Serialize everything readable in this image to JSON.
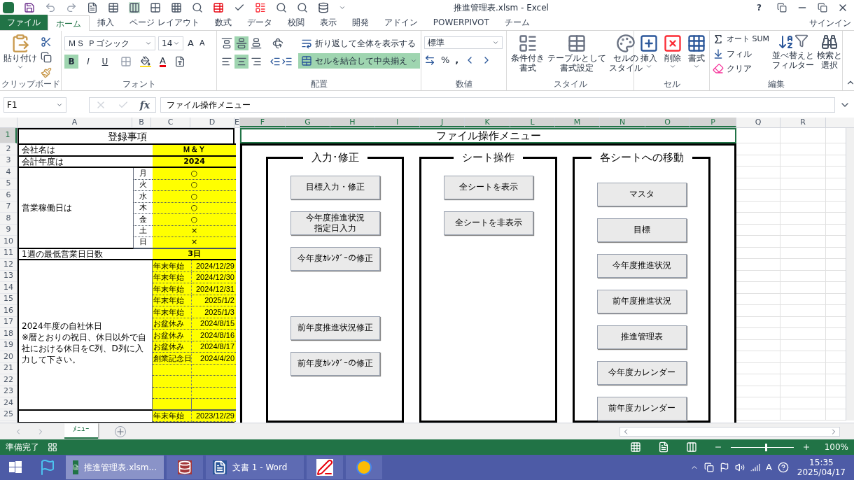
{
  "window": {
    "title": "推進管理表.xlsm - Excel",
    "help": "?"
  },
  "ribbon_tabs": [
    {
      "label": "ファイル",
      "kind": "file",
      "selected": false
    },
    {
      "label": "ホーム",
      "kind": "tab",
      "selected": true
    },
    {
      "label": "挿入",
      "kind": "tab",
      "selected": false
    },
    {
      "label": "ページ レイアウト",
      "kind": "tab",
      "selected": false
    },
    {
      "label": "数式",
      "kind": "tab",
      "selected": false
    },
    {
      "label": "データ",
      "kind": "tab",
      "selected": false
    },
    {
      "label": "校閲",
      "kind": "tab",
      "selected": false
    },
    {
      "label": "表示",
      "kind": "tab",
      "selected": false
    },
    {
      "label": "開発",
      "kind": "tab",
      "selected": false
    },
    {
      "label": "アドイン",
      "kind": "tab",
      "selected": false
    },
    {
      "label": "POWERPIVOT",
      "kind": "tab",
      "selected": false
    },
    {
      "label": "チーム",
      "kind": "tab",
      "selected": false
    }
  ],
  "sign_in": "サインイン",
  "ribbon": {
    "clipboard": {
      "label": "クリップボード",
      "paste": "貼り付け"
    },
    "font": {
      "label": "フォント",
      "name": "ＭＳ Ｐゴシック",
      "size": "14",
      "grow": "A",
      "shrink": "A",
      "font_color": "A",
      "styles": [
        {
          "kind": "bold",
          "text": "B",
          "selected": true
        },
        {
          "kind": "italic",
          "text": "I",
          "selected": false
        },
        {
          "kind": "underline",
          "text": "U",
          "selected": false
        }
      ]
    },
    "alignment": {
      "label": "配置",
      "wrap": "折り返して全体を表示する",
      "merge": "セルを結合して中央揃え",
      "merge_selected": true,
      "vertical": [
        {
          "kind": "top",
          "selected": false
        },
        {
          "kind": "middle",
          "selected": true
        },
        {
          "kind": "bottom",
          "selected": false
        }
      ],
      "horizontal": [
        {
          "kind": "left",
          "selected": false
        },
        {
          "kind": "center",
          "selected": true
        },
        {
          "kind": "right",
          "selected": false
        }
      ]
    },
    "number": {
      "label": "数値",
      "format": "標準",
      "percent": "%",
      "comma": ","
    },
    "styles": {
      "label": "スタイル",
      "buttons": [
        {
          "kind": "conditional",
          "lines": [
            "条件付き",
            "書式"
          ]
        },
        {
          "kind": "table",
          "lines": [
            "テーブルとして",
            "書式設定"
          ]
        },
        {
          "kind": "cellstyle",
          "lines": [
            "セルの",
            "スタイル"
          ]
        }
      ]
    },
    "cells": {
      "label": "セル",
      "buttons": [
        {
          "kind": "insert",
          "label": "挿入"
        },
        {
          "kind": "delete",
          "label": "削除"
        },
        {
          "kind": "format",
          "label": "書式"
        }
      ]
    },
    "editing": {
      "label": "編集",
      "autosum": "オート SUM",
      "fill": "フィル",
      "clear": "クリア",
      "sort": [
        "並べ替えと",
        "フィルター"
      ],
      "find": [
        "検索と",
        "選択"
      ]
    }
  },
  "formula_bar": {
    "name_box": "F1",
    "fx": "fx",
    "formula": "ファイル操作メニュー"
  },
  "columns": [
    {
      "label": "A",
      "selected": false
    },
    {
      "label": "B",
      "selected": false
    },
    {
      "label": "C",
      "selected": false
    },
    {
      "label": "D",
      "selected": false
    },
    {
      "label": "E",
      "selected": false
    },
    {
      "label": "F",
      "selected": true
    },
    {
      "label": "G",
      "selected": true
    },
    {
      "label": "H",
      "selected": true
    },
    {
      "label": "I",
      "selected": true
    },
    {
      "label": "J",
      "selected": true
    },
    {
      "label": "K",
      "selected": true
    },
    {
      "label": "L",
      "selected": true
    },
    {
      "label": "M",
      "selected": true
    },
    {
      "label": "N",
      "selected": true
    },
    {
      "label": "O",
      "selected": true
    },
    {
      "label": "P",
      "selected": true
    },
    {
      "label": "Q",
      "selected": false
    },
    {
      "label": "R",
      "selected": false
    }
  ],
  "rows": [
    {
      "label": "1",
      "selected": true
    },
    {
      "label": "2",
      "selected": false
    },
    {
      "label": "3",
      "selected": false
    },
    {
      "label": "4",
      "selected": false
    },
    {
      "label": "5",
      "selected": false
    },
    {
      "label": "6",
      "selected": false
    },
    {
      "label": "7",
      "selected": false
    },
    {
      "label": "8",
      "selected": false
    },
    {
      "label": "9",
      "selected": false
    },
    {
      "label": "10",
      "selected": false
    },
    {
      "label": "11",
      "selected": false
    },
    {
      "label": "12",
      "selected": false
    },
    {
      "label": "13",
      "selected": false
    },
    {
      "label": "14",
      "selected": false
    },
    {
      "label": "15",
      "selected": false
    },
    {
      "label": "16",
      "selected": false
    },
    {
      "label": "17",
      "selected": false
    },
    {
      "label": "18",
      "selected": false
    },
    {
      "label": "19",
      "selected": false
    },
    {
      "label": "20",
      "selected": false
    },
    {
      "label": "21",
      "selected": false
    },
    {
      "label": "22",
      "selected": false
    },
    {
      "label": "23",
      "selected": false
    },
    {
      "label": "24",
      "selected": false
    },
    {
      "label": "25",
      "selected": false
    }
  ],
  "registration": {
    "title": "登録事項",
    "company": {
      "label": "会社名は",
      "value": "Ｍ＆Ｙ"
    },
    "fiscal_year": {
      "label": "会計年度は",
      "value": "2024"
    },
    "workdays": {
      "label": "営業稼働日は",
      "days": [
        {
          "day": "月",
          "mark": "○"
        },
        {
          "day": "火",
          "mark": "○"
        },
        {
          "day": "水",
          "mark": "○"
        },
        {
          "day": "木",
          "mark": "○"
        },
        {
          "day": "金",
          "mark": "○"
        },
        {
          "day": "土",
          "mark": "×"
        },
        {
          "day": "日",
          "mark": "×"
        }
      ]
    },
    "min_days": {
      "label": "1週の最低営業日日数",
      "value": "3日"
    },
    "holidays": {
      "note": "2024年度の自社休日\n※暦とおりの祝日、休日以外で自社における休日をC列、D列に入力して下さい。",
      "items": [
        {
          "label": "年末年始",
          "date": "2024/12/29"
        },
        {
          "label": "年末年始",
          "date": "2024/12/30"
        },
        {
          "label": "年末年始",
          "date": "2024/12/31"
        },
        {
          "label": "年末年始",
          "date": "2025/1/2"
        },
        {
          "label": "年末年始",
          "date": "2025/1/3"
        },
        {
          "label": "お盆休み",
          "date": "2024/8/15"
        },
        {
          "label": "お盆休み",
          "date": "2024/8/16"
        },
        {
          "label": "お盆休み",
          "date": "2024/8/17"
        },
        {
          "label": "創業記念日",
          "date": "2024/4/20"
        }
      ]
    },
    "next": {
      "label": "年末年始",
      "date": "2023/12/29"
    }
  },
  "menu": {
    "title": "ファイル操作メニュー",
    "groups": [
      {
        "title": "入力･修正",
        "buttons": [
          {
            "lines": [
              "目標入力・修正"
            ]
          },
          {
            "lines": [
              "今年度推進状況",
              "指定日入力"
            ]
          },
          {
            "lines": [
              "今年度ｶﾚﾝﾀﾞｰの修正"
            ]
          },
          {
            "lines": [
              "前年度推進状況修正"
            ]
          },
          {
            "lines": [
              "前年度ｶﾚﾝﾀﾞｰの修正"
            ]
          }
        ]
      },
      {
        "title": "シート操作",
        "buttons": [
          {
            "lines": [
              "全シートを表示"
            ]
          },
          {
            "lines": [
              "全シートを非表示"
            ]
          }
        ]
      },
      {
        "title": "各シートへの移動",
        "buttons": [
          {
            "lines": [
              "マスタ"
            ]
          },
          {
            "lines": [
              "目標"
            ]
          },
          {
            "lines": [
              "今年度推進状況"
            ]
          },
          {
            "lines": [
              "前年度推進状況"
            ]
          },
          {
            "lines": [
              "推進管理表"
            ]
          },
          {
            "lines": [
              "今年度カレンダー"
            ]
          },
          {
            "lines": [
              "前年度カレンダー"
            ]
          }
        ]
      }
    ]
  },
  "sheet_tabs": [
    {
      "label": "ﾒﾆｭｰ",
      "selected": true
    }
  ],
  "status_bar": {
    "status": "準備完了",
    "zoom": "100%",
    "level": 0.55
  },
  "taskbar": {
    "apps": [
      {
        "kind": "excel",
        "label": "推進管理表.xlsm...",
        "active": true
      },
      {
        "kind": "access",
        "active": false
      },
      {
        "kind": "word",
        "label": "文書 1 - Word",
        "active": false
      },
      {
        "kind": "notepad",
        "active": false
      },
      {
        "kind": "chrome",
        "active": false
      }
    ],
    "ime": "A",
    "time": "15:35",
    "date": "2025/04/17"
  }
}
